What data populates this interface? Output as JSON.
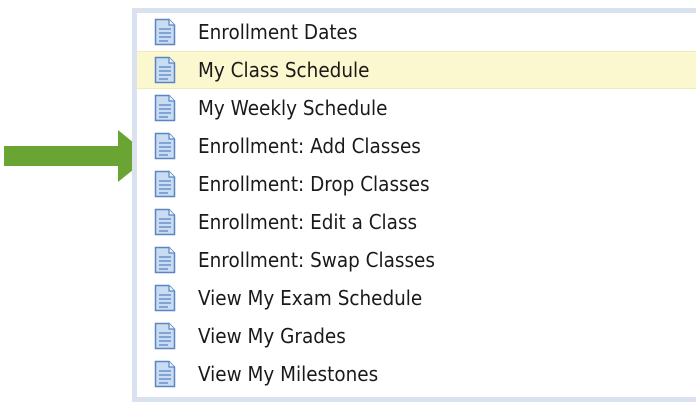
{
  "menu": {
    "items": [
      {
        "label": "Enrollment Dates",
        "icon": "document-icon",
        "selected": false
      },
      {
        "label": "My Class Schedule",
        "icon": "document-icon",
        "selected": true
      },
      {
        "label": "My Weekly Schedule",
        "icon": "document-icon",
        "selected": false
      },
      {
        "label": "Enrollment: Add Classes",
        "icon": "document-icon",
        "selected": false,
        "pointed": true
      },
      {
        "label": "Enrollment: Drop Classes",
        "icon": "document-icon",
        "selected": false
      },
      {
        "label": "Enrollment: Edit a Class",
        "icon": "document-icon",
        "selected": false
      },
      {
        "label": "Enrollment: Swap Classes",
        "icon": "document-icon",
        "selected": false
      },
      {
        "label": "View My Exam Schedule",
        "icon": "document-icon",
        "selected": false
      },
      {
        "label": "View My Grades",
        "icon": "document-icon",
        "selected": false
      },
      {
        "label": "View My Milestones",
        "icon": "document-icon",
        "selected": false
      }
    ]
  },
  "colors": {
    "arrow": "#6aa534",
    "highlight": "#fbf8cf",
    "panel_border": "#d9e2ee",
    "icon_fill": "#c9dcf2",
    "icon_stroke": "#5b86c4"
  }
}
